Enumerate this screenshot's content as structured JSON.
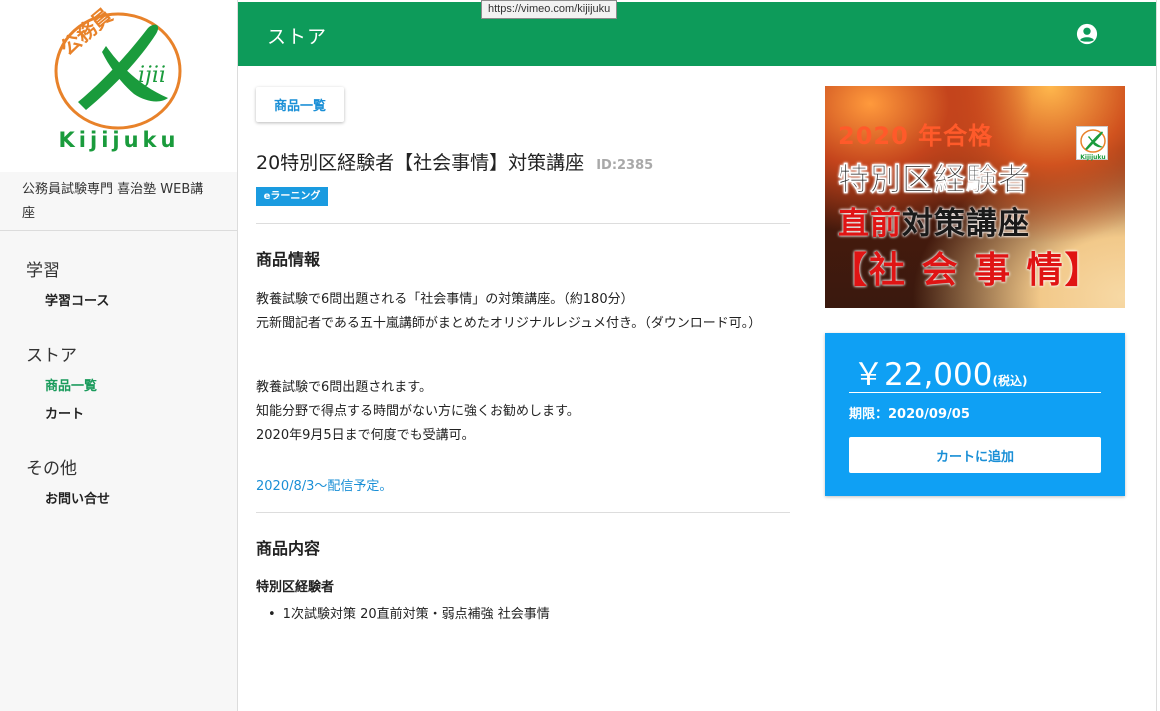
{
  "browser": {
    "tooltip_url": "https://vimeo.com/kijijuku"
  },
  "brand": {
    "logo_text": "Kijijuku",
    "logo_badge_text": "公務員",
    "site_name": "公務員試験専門 喜治塾 WEB講座",
    "brand_green": "#1a9b3c",
    "header_green": "#0d9b5a",
    "logo_orange": "#e8822a"
  },
  "header": {
    "title": "ストア",
    "account_icon": "account-circle-icon"
  },
  "sidebar": {
    "groups": [
      {
        "heading": "学習",
        "items": [
          {
            "label": "学習コース"
          }
        ]
      },
      {
        "heading": "ストア",
        "items": [
          {
            "label": "商品一覧",
            "active": true
          },
          {
            "label": "カート"
          }
        ]
      },
      {
        "heading": "その他",
        "items": [
          {
            "label": "お問い合せ"
          }
        ]
      }
    ]
  },
  "main": {
    "back_button": "商品一覧",
    "product_title": "20特別区経験者【社会事情】対策講座",
    "product_id": "ID:2385",
    "badge": "eラーニング",
    "info_heading": "商品情報",
    "info_para1_line1": "教養試験で6問出題される「社会事情」の対策講座。（約180分）",
    "info_para1_line2": "元新聞記者である五十嵐講師がまとめたオリジナルレジュメ付き。（ダウンロード可。）",
    "info_para2_line1": "教養試験で6問出題されます。",
    "info_para2_line2": "知能分野で得点する時間がない方に強くお勧めします。",
    "info_para2_line3": "2020年9月5日まで何度でも受講可。",
    "release_note": "2020/8/3～配信予定。",
    "contents_heading": "商品内容",
    "contents_subheading": "特別区経験者",
    "contents_items": [
      "1次試験対策 20直前対策・弱点補強 社会事情"
    ]
  },
  "banner": {
    "line1": "2020 年合格",
    "line2": "特別区経験者",
    "line3_red": "直前",
    "line3_black": "対策講座",
    "line4": "【社 会 事 情】",
    "mini_logo_text": "Kijijuku"
  },
  "price": {
    "amount": "￥22,000",
    "tax_note": "(税込)",
    "period": "期限：2020/09/05",
    "cart_button": "カートに追加",
    "card_color": "#0fa0f4"
  }
}
